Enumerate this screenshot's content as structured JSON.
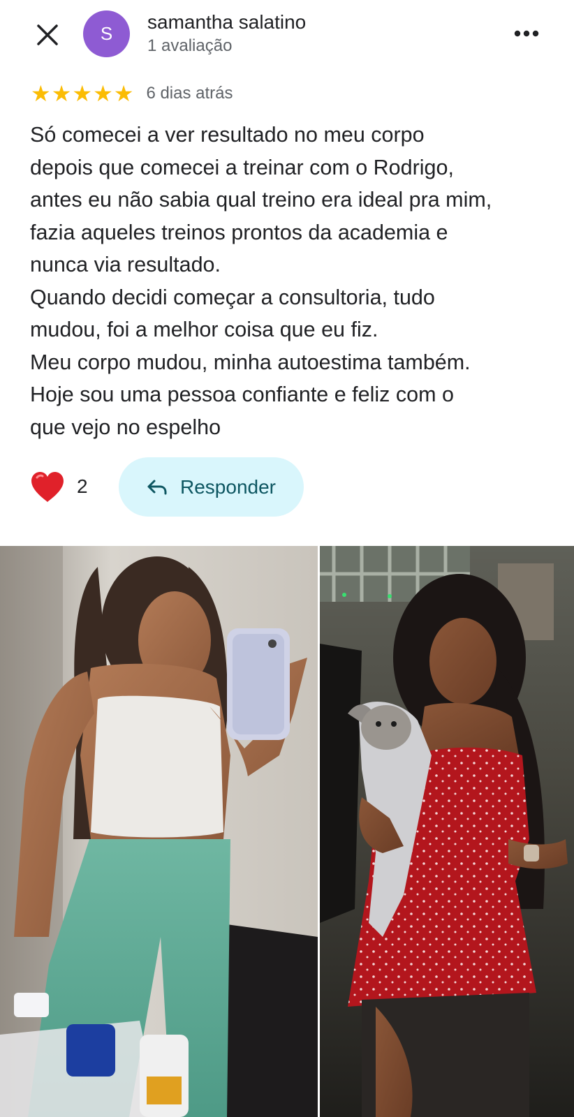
{
  "header": {
    "avatar_letter": "S",
    "user_name": "samantha salatino",
    "user_subtitle": "1 avaliação",
    "close_icon": "close-icon",
    "more_icon": "more-horizontal-icon"
  },
  "review": {
    "rating": 5,
    "max_rating": 5,
    "date": "6 dias atrás",
    "text_lines": [
      "Só comecei a ver resultado no meu corpo",
      "depois que comecei a treinar com o Rodrigo,",
      "antes eu não sabia qual treino era ideal pra mim,",
      "fazia aqueles treinos prontos da academia e",
      "nunca via resultado.",
      "Quando decidi começar a consultoria, tudo",
      "mudou, foi a melhor coisa que eu fiz.",
      "Meu corpo mudou, minha autoestima também.",
      "Hoje sou uma pessoa confiante e feliz com o",
      "que vejo no espelho"
    ]
  },
  "actions": {
    "heart_icon": "heart-icon",
    "like_count": "2",
    "reply_icon": "reply-arrow-icon",
    "reply_label": "Responder"
  },
  "colors": {
    "avatar": "#8e5bd3",
    "star": "#fbbc04",
    "reply_bg": "#d9f6fc",
    "reply_text": "#0d5661",
    "heart": "#e0212a"
  }
}
